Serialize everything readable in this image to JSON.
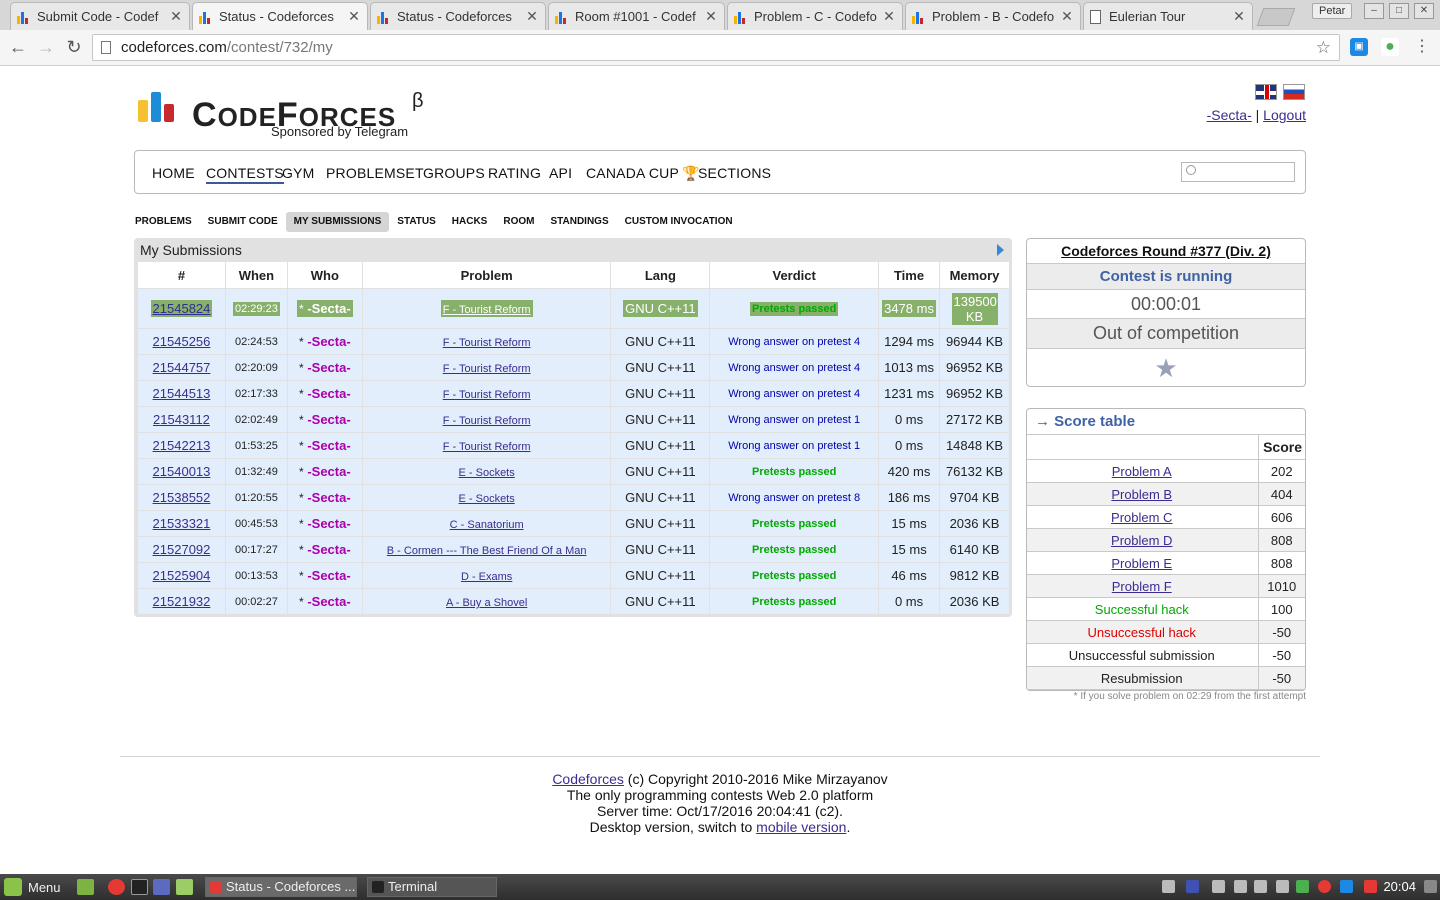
{
  "browser": {
    "tabs": [
      {
        "title": "Submit Code - Codef",
        "active": false,
        "icon": "codeforces-favicon"
      },
      {
        "title": "Status - Codeforces",
        "active": true,
        "icon": "codeforces-favicon"
      },
      {
        "title": "Status - Codeforces",
        "active": false,
        "icon": "codeforces-favicon"
      },
      {
        "title": "Room #1001 - Codef",
        "active": false,
        "icon": "codeforces-favicon"
      },
      {
        "title": "Problem - C - Codefo",
        "active": false,
        "icon": "codeforces-favicon"
      },
      {
        "title": "Problem - B - Codefo",
        "active": false,
        "icon": "codeforces-favicon"
      },
      {
        "title": "Eulerian Tour",
        "active": false,
        "icon": "document-icon"
      }
    ],
    "profile_name": "Petar",
    "url_host": "codeforces.com",
    "url_path": "/contest/732/my"
  },
  "site": {
    "logo_text": "CODEFORCES",
    "beta_mark": "β",
    "sponsor": "Sponsored by Telegram",
    "user_handle": "-Secta-",
    "separator": "|",
    "logout": "Logout",
    "main_menu": [
      "Home",
      "Contests",
      "Gym",
      "Problemset",
      "Groups",
      "Rating",
      "API",
      "Canada Cup",
      "Sections"
    ],
    "main_menu_current": "Contests",
    "second_menu": [
      "Problems",
      "Submit Code",
      "My Submissions",
      "Status",
      "Hacks",
      "Room",
      "Standings",
      "Custom Invocation"
    ],
    "second_menu_selected": "My Submissions"
  },
  "submissions": {
    "caption": "My Submissions",
    "headers": [
      "#",
      "When",
      "Who",
      "Problem",
      "Lang",
      "Verdict",
      "Time",
      "Memory"
    ],
    "rows": [
      {
        "id": "21545824",
        "when": "02:29:23",
        "who_prefix": "*",
        "who": "-Secta-",
        "problem": "F - Tourist Reform",
        "lang": "GNU C++11",
        "verdict": "Pretests passed",
        "ok": true,
        "time": "3478 ms",
        "memory": "139500 KB"
      },
      {
        "id": "21545256",
        "when": "02:24:53",
        "who_prefix": "*",
        "who": "-Secta-",
        "problem": "F - Tourist Reform",
        "lang": "GNU C++11",
        "verdict": "Wrong answer on pretest 4",
        "ok": false,
        "time": "1294 ms",
        "memory": "96944 KB"
      },
      {
        "id": "21544757",
        "when": "02:20:09",
        "who_prefix": "*",
        "who": "-Secta-",
        "problem": "F - Tourist Reform",
        "lang": "GNU C++11",
        "verdict": "Wrong answer on pretest 4",
        "ok": false,
        "time": "1013 ms",
        "memory": "96952 KB"
      },
      {
        "id": "21544513",
        "when": "02:17:33",
        "who_prefix": "*",
        "who": "-Secta-",
        "problem": "F - Tourist Reform",
        "lang": "GNU C++11",
        "verdict": "Wrong answer on pretest 4",
        "ok": false,
        "time": "1231 ms",
        "memory": "96952 KB"
      },
      {
        "id": "21543112",
        "when": "02:02:49",
        "who_prefix": "*",
        "who": "-Secta-",
        "problem": "F - Tourist Reform",
        "lang": "GNU C++11",
        "verdict": "Wrong answer on pretest 1",
        "ok": false,
        "time": "0 ms",
        "memory": "27172 KB"
      },
      {
        "id": "21542213",
        "when": "01:53:25",
        "who_prefix": "*",
        "who": "-Secta-",
        "problem": "F - Tourist Reform",
        "lang": "GNU C++11",
        "verdict": "Wrong answer on pretest 1",
        "ok": false,
        "time": "0 ms",
        "memory": "14848 KB"
      },
      {
        "id": "21540013",
        "when": "01:32:49",
        "who_prefix": "*",
        "who": "-Secta-",
        "problem": "E - Sockets",
        "lang": "GNU C++11",
        "verdict": "Pretests passed",
        "ok": true,
        "time": "420 ms",
        "memory": "76132 KB"
      },
      {
        "id": "21538552",
        "when": "01:20:55",
        "who_prefix": "*",
        "who": "-Secta-",
        "problem": "E - Sockets",
        "lang": "GNU C++11",
        "verdict": "Wrong answer on pretest 8",
        "ok": false,
        "time": "186 ms",
        "memory": "9704 KB"
      },
      {
        "id": "21533321",
        "when": "00:45:53",
        "who_prefix": "*",
        "who": "-Secta-",
        "problem": "C - Sanatorium",
        "lang": "GNU C++11",
        "verdict": "Pretests passed",
        "ok": true,
        "time": "15 ms",
        "memory": "2036 KB"
      },
      {
        "id": "21527092",
        "when": "00:17:27",
        "who_prefix": "*",
        "who": "-Secta-",
        "problem": "B - Cormen --- The Best Friend Of a Man",
        "lang": "GNU C++11",
        "verdict": "Pretests passed",
        "ok": true,
        "time": "15 ms",
        "memory": "6140 KB"
      },
      {
        "id": "21525904",
        "when": "00:13:53",
        "who_prefix": "*",
        "who": "-Secta-",
        "problem": "D - Exams",
        "lang": "GNU C++11",
        "verdict": "Pretests passed",
        "ok": true,
        "time": "46 ms",
        "memory": "9812 KB"
      },
      {
        "id": "21521932",
        "when": "00:02:27",
        "who_prefix": "*",
        "who": "-Secta-",
        "problem": "A - Buy a Shovel",
        "lang": "GNU C++11",
        "verdict": "Pretests passed",
        "ok": true,
        "time": "0 ms",
        "memory": "2036 KB"
      }
    ]
  },
  "contest": {
    "name": "Codeforces Round #377 (Div. 2)",
    "status": "Contest is running",
    "timer": "00:00:01",
    "participation": "Out of competition"
  },
  "score_table": {
    "header": "→ Score table",
    "score_col": "Score",
    "rows": [
      {
        "label": "Problem A",
        "score": "202",
        "kind": "link"
      },
      {
        "label": "Problem B",
        "score": "404",
        "kind": "link"
      },
      {
        "label": "Problem C",
        "score": "606",
        "kind": "link"
      },
      {
        "label": "Problem D",
        "score": "808",
        "kind": "link"
      },
      {
        "label": "Problem E",
        "score": "808",
        "kind": "link"
      },
      {
        "label": "Problem F",
        "score": "1010",
        "kind": "link"
      },
      {
        "label": "Successful hack",
        "score": "100",
        "kind": "ok"
      },
      {
        "label": "Unsuccessful hack",
        "score": "-50",
        "kind": "bad"
      },
      {
        "label": "Unsuccessful submission",
        "score": "-50",
        "kind": "plain"
      },
      {
        "label": "Resubmission",
        "score": "-50",
        "kind": "plain"
      }
    ],
    "footnote": "* If you solve problem on 02:29 from the first attempt"
  },
  "footer": {
    "brand": "Codeforces",
    "copyright": " (c) Copyright 2010-2016 Mike Mirzayanov",
    "line2": "The only programming contests Web 2.0 platform",
    "line3": "Server time: Oct/17/2016 20:04:41 (c2).",
    "line4_prefix": "Desktop version, switch to ",
    "mobile_link": "mobile version",
    "line4_suffix": "."
  },
  "taskbar": {
    "menu_label": "Menu",
    "tasks": [
      {
        "title": "Status - Codeforces ...",
        "active": true
      },
      {
        "title": "Terminal",
        "active": false
      }
    ],
    "clock": "20:04"
  },
  "colors": {
    "accent": "#3f62a5",
    "link": "#3b2d8f",
    "verdict_ok": "#00aa00",
    "verdict_wa": "#0000aa",
    "handle": "#aa00aa",
    "highlight_row": "#87b06a"
  }
}
